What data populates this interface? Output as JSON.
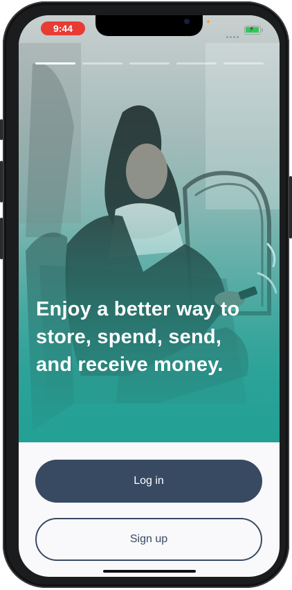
{
  "status_bar": {
    "time": "9:44",
    "time_pill_color": "#e83b33",
    "battery_color": "#35c759"
  },
  "onboarding": {
    "slide_count": 5,
    "active_slide": 1,
    "headline": "Enjoy a better way to store, spend, send, and receive money.",
    "hero_image": "woman-with-phone-on-bench-photo"
  },
  "actions": {
    "login_label": "Log in",
    "signup_label": "Sign up"
  },
  "colors": {
    "primary": "#374a62",
    "teal": "#26a096",
    "background": "#f9f8fb"
  }
}
